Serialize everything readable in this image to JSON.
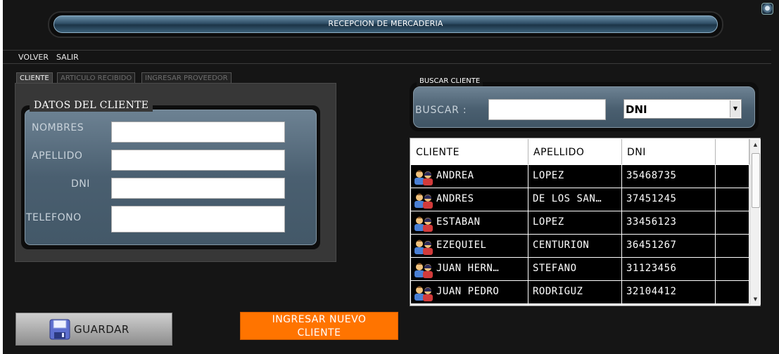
{
  "window": {
    "title": "RECEPCION DE MERCADERIA"
  },
  "menu": {
    "items": [
      "VOLVER",
      "SALIR"
    ]
  },
  "tabs": [
    "CLIENTE",
    "ARTICULO RECIBIDO",
    "INGRESAR PROVEEDOR"
  ],
  "client_form": {
    "legend": "DATOS DEL CLIENTE",
    "labels": {
      "nombres": "NOMBRES",
      "apellido": "APELLIDO",
      "dni": "DNI",
      "telefono": "TELEFONO"
    },
    "values": {
      "nombres": "",
      "apellido": "",
      "dni": "",
      "telefono": ""
    }
  },
  "search": {
    "legend": "BUSCAR CLIENTE",
    "label": "BUSCAR :",
    "value": "",
    "filter_selected": "DNI"
  },
  "grid": {
    "columns": [
      "CLIENTE",
      "APELLIDO",
      "DNI",
      ""
    ],
    "rows": [
      {
        "cliente": "ANDREA",
        "apellido": "LOPEZ",
        "dni": "35468735"
      },
      {
        "cliente": "ANDRES",
        "apellido": "DE LOS SAN…",
        "dni": "37451245"
      },
      {
        "cliente": "ESTABAN",
        "apellido": "LOPEZ",
        "dni": "33456123"
      },
      {
        "cliente": "EZEQUIEL",
        "apellido": "CENTURION",
        "dni": "36451267"
      },
      {
        "cliente": "JUAN HERN…",
        "apellido": "STEFANO",
        "dni": "31123456"
      },
      {
        "cliente": "JUAN PEDRO",
        "apellido": "RODRIGUZ",
        "dni": "32104412"
      }
    ],
    "row_icon": "users-icon"
  },
  "buttons": {
    "guardar": "GUARDAR",
    "nuevo_line1": "INGRESAR NUEVO",
    "nuevo_line2": "CLIENTE"
  }
}
